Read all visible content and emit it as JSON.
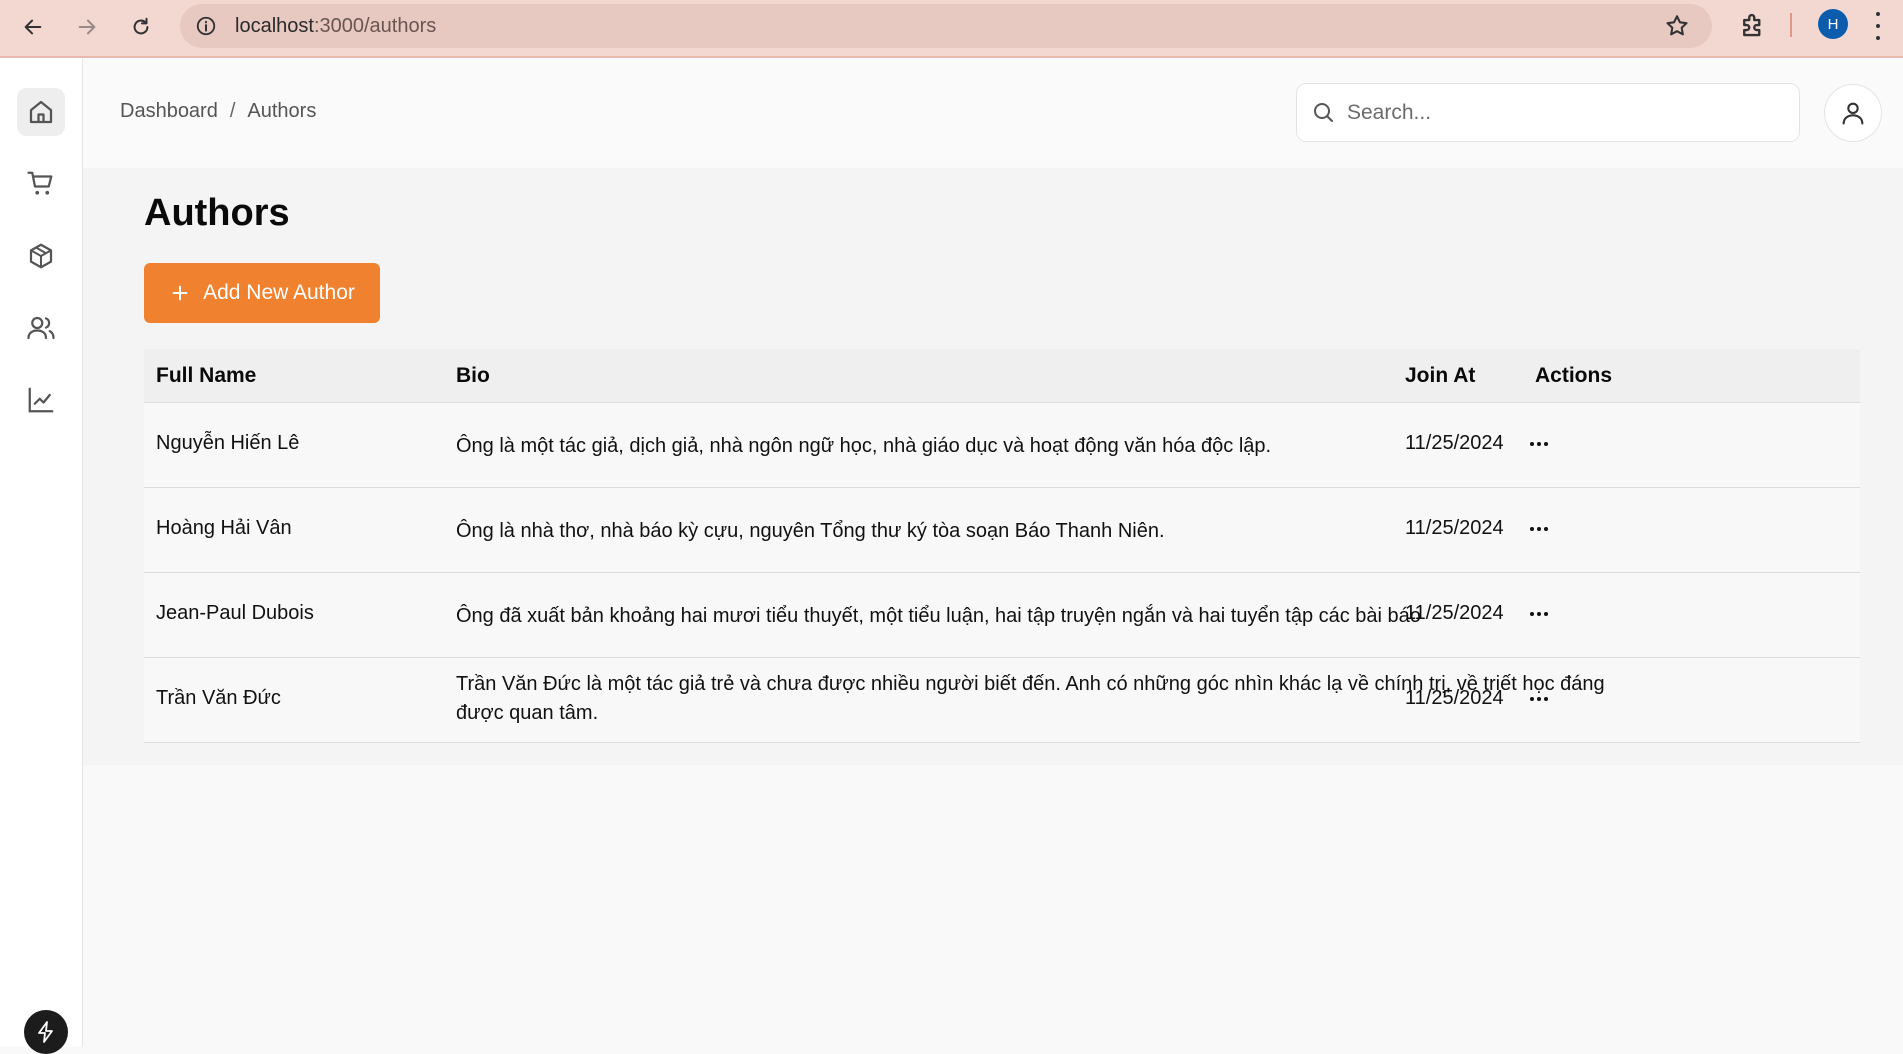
{
  "browser": {
    "url_host": "localhost",
    "url_path": ":3000/authors",
    "profile_initial": "H"
  },
  "sidebar": {
    "items": [
      {
        "icon": "home-icon",
        "active": true
      },
      {
        "icon": "shopping-cart-icon",
        "active": false
      },
      {
        "icon": "package-icon",
        "active": false
      },
      {
        "icon": "users-icon",
        "active": false
      },
      {
        "icon": "line-chart-icon",
        "active": false
      }
    ],
    "bottom_icon": "bolt-icon"
  },
  "header": {
    "breadcrumb": [
      "Dashboard",
      "Authors"
    ],
    "search_placeholder": "Search..."
  },
  "main": {
    "title": "Authors",
    "add_button_label": "Add New Author",
    "table": {
      "columns": [
        "Full Name",
        "Bio",
        "Join At",
        "Actions"
      ],
      "rows": [
        {
          "name": "Nguyễn Hiến Lê",
          "bio": "Ông là một tác giả, dịch giả, nhà ngôn ngữ học, nhà giáo dục và hoạt động văn hóa độc lập.",
          "join_at": "11/25/2024"
        },
        {
          "name": "Hoàng Hải Vân",
          "bio": "Ông là nhà thơ, nhà báo kỳ cựu, nguyên Tổng thư ký tòa soạn Báo Thanh Niên.",
          "join_at": "11/25/2024"
        },
        {
          "name": "Jean-Paul Dubois",
          "bio": "Ông đã xuất bản khoảng hai mươi tiểu thuyết, một tiểu luận, hai tập truyện ngắn và hai tuyển tập các bài báo",
          "join_at": "11/25/2024"
        },
        {
          "name": "Trần Văn Đức",
          "bio": "Trần Văn Đức là một tác giả trẻ và chưa được nhiều người biết đến. Anh có những góc nhìn khác lạ về chính trị, về triết học đáng được quan tâm.",
          "join_at": "11/25/2024"
        }
      ]
    }
  },
  "colors": {
    "accent": "#f0812e",
    "browser_bar": "#f3d8d2",
    "profile": "#0b5cad"
  }
}
